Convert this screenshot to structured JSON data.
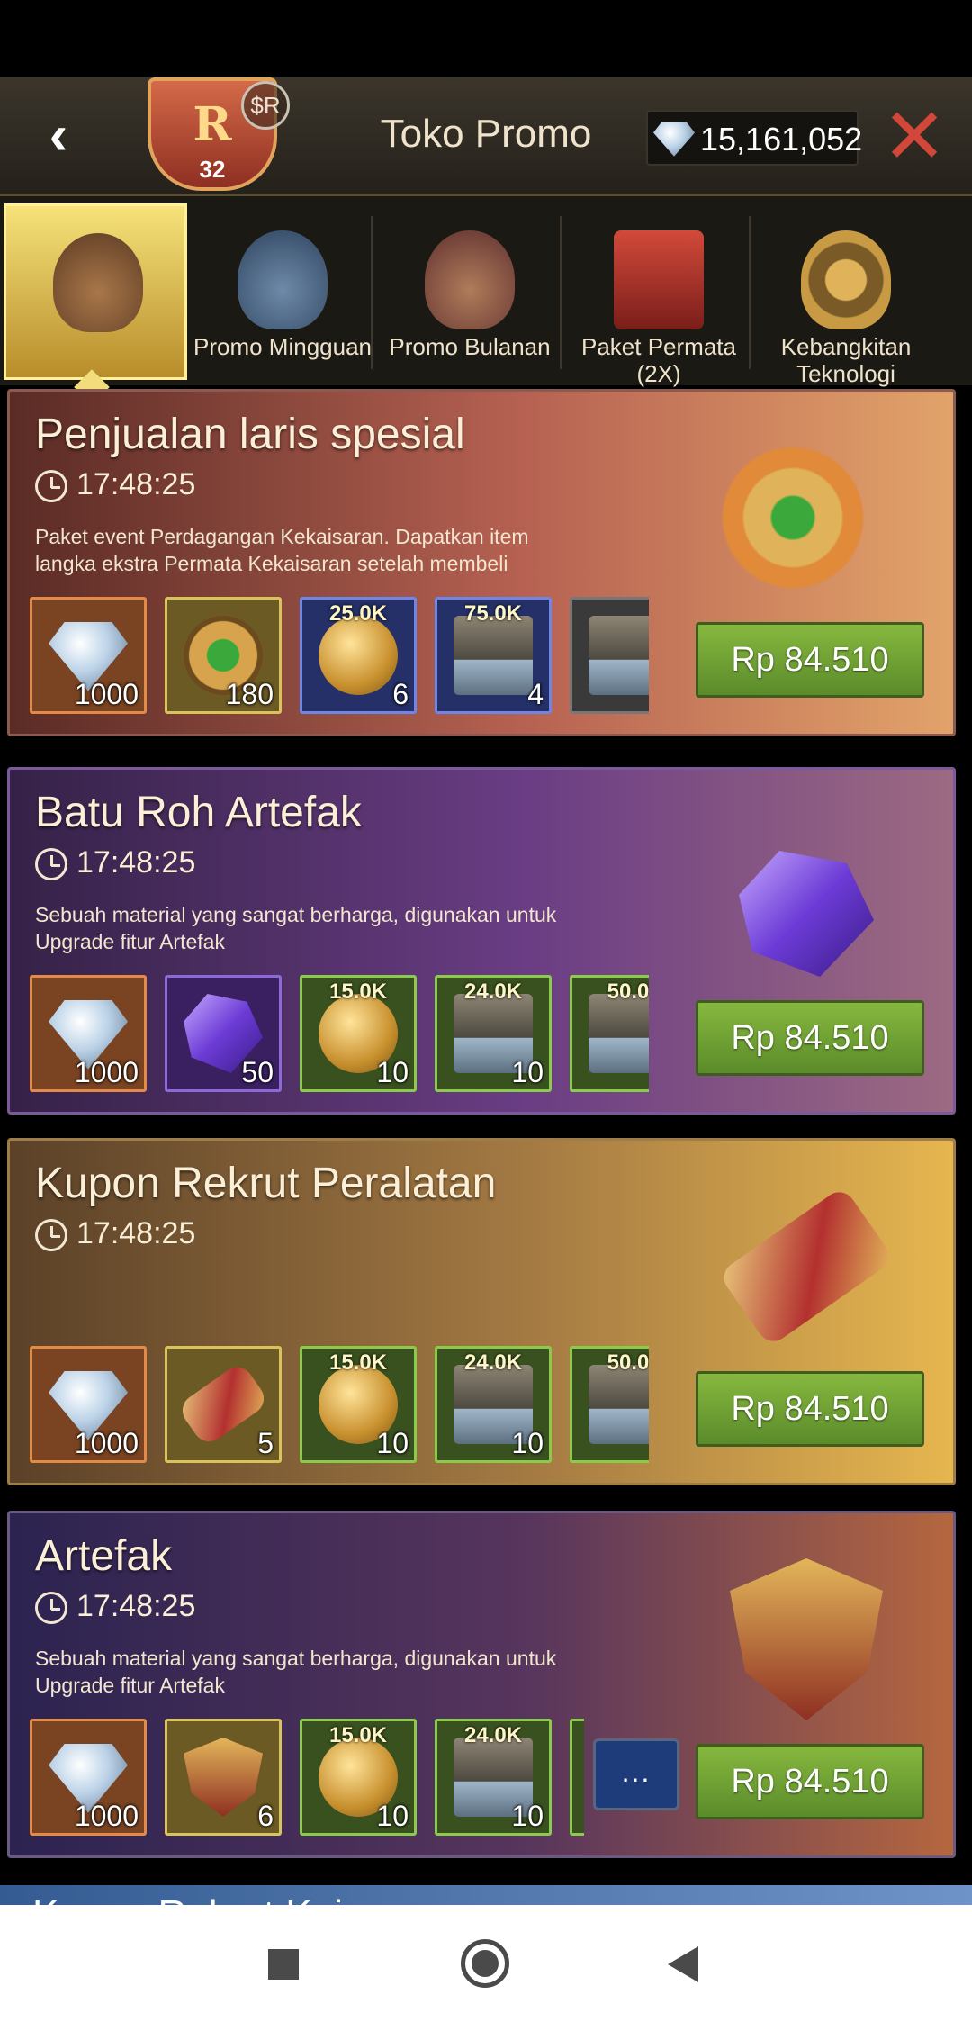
{
  "header": {
    "title": "Toko Promo",
    "emblem_letter": "R",
    "emblem_level": "32",
    "emblem_badge": "$R",
    "gems": "15,161,052"
  },
  "tabs": [
    {
      "label": "",
      "icon": "coin-bag-1-icon",
      "active": true
    },
    {
      "label": "Promo Mingguan",
      "icon": "coin-bag-7-icon"
    },
    {
      "label": "Promo Bulanan",
      "icon": "coin-bag-30-icon"
    },
    {
      "label": "Paket Permata (2X)",
      "icon": "gift-box-icon"
    },
    {
      "label": "Kebangkitan Teknologi",
      "icon": "armillary-sphere-icon"
    }
  ],
  "cards": [
    {
      "title": "Penjualan laris spesial",
      "timer": "17:48:25",
      "desc": "Paket event Perdagangan Kekaisaran. Dapatkan item langka ekstra Permata Kekaisaran setelah membeli",
      "price": "Rp 84.510",
      "items": [
        {
          "qty": "1000",
          "top": ""
        },
        {
          "qty": "180",
          "top": ""
        },
        {
          "qty": "6",
          "top": "25.0K"
        },
        {
          "qty": "4",
          "top": "75.0K"
        },
        {
          "qty": "",
          "top": ""
        }
      ]
    },
    {
      "title": "Batu Roh Artefak",
      "timer": "17:48:25",
      "desc": "Sebuah material yang sangat berharga, digunakan untuk Upgrade fitur Artefak",
      "price": "Rp 84.510",
      "items": [
        {
          "qty": "1000",
          "top": ""
        },
        {
          "qty": "50",
          "top": ""
        },
        {
          "qty": "10",
          "top": "15.0K"
        },
        {
          "qty": "10",
          "top": "24.0K"
        },
        {
          "qty": "",
          "top": "50.0"
        }
      ]
    },
    {
      "title": "Kupon Rekrut Peralatan",
      "timer": "17:48:25",
      "desc": "",
      "price": "Rp 84.510",
      "items": [
        {
          "qty": "1000",
          "top": ""
        },
        {
          "qty": "5",
          "top": ""
        },
        {
          "qty": "10",
          "top": "15.0K"
        },
        {
          "qty": "10",
          "top": "24.0K"
        },
        {
          "qty": "",
          "top": "50.0"
        }
      ]
    },
    {
      "title": "Artefak",
      "timer": "17:48:25",
      "desc": "Sebuah material yang sangat berharga, digunakan untuk Upgrade fitur Artefak",
      "price": "Rp 84.510",
      "more": "...",
      "items": [
        {
          "qty": "1000",
          "top": ""
        },
        {
          "qty": "6",
          "top": ""
        },
        {
          "qty": "10",
          "top": "15.0K"
        },
        {
          "qty": "10",
          "top": "24.0K"
        }
      ]
    }
  ],
  "peek_title": "Kupon Rekrut Kais"
}
